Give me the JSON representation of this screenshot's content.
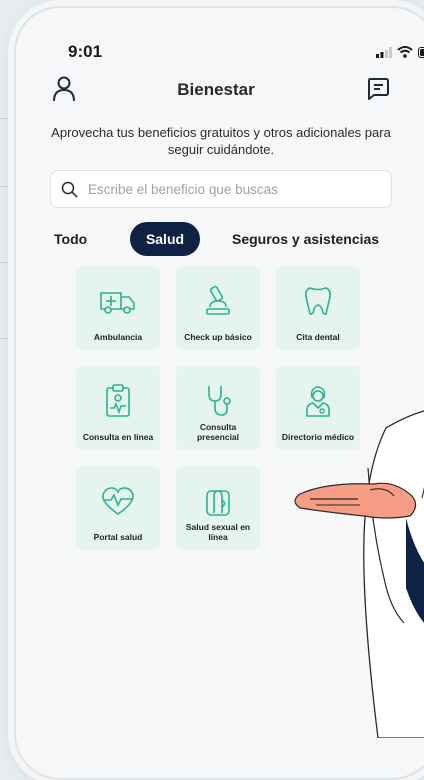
{
  "status_bar": {
    "time": "9:01"
  },
  "header": {
    "title": "Bienestar"
  },
  "intro_text": "Aprovecha tus beneficios gratuitos y otros adicionales para seguir cuidándote.",
  "search": {
    "placeholder": "Escribe el beneficio que buscas"
  },
  "tabs": [
    {
      "label": "Todo",
      "active": false
    },
    {
      "label": "Salud",
      "active": true
    },
    {
      "label": "Seguros y asistencias",
      "active": false
    }
  ],
  "cards": [
    {
      "label": "Ambulancia",
      "icon": "ambulance-icon"
    },
    {
      "label": "Check up básico",
      "icon": "microscope-icon"
    },
    {
      "label": "Cita dental",
      "icon": "tooth-icon"
    },
    {
      "label": "Consulta en línea",
      "icon": "clipboard-icon"
    },
    {
      "label": "Consulta presencial",
      "icon": "stethoscope-icon"
    },
    {
      "label": "Directorio médico",
      "icon": "doctor-icon"
    },
    {
      "label": "Portal salud",
      "icon": "heart-pulse-icon"
    },
    {
      "label": "Salud sexual en línea",
      "icon": "condom-icon"
    }
  ],
  "colors": {
    "accent": "#0e2243",
    "card_bg": "#e5f5ee",
    "icon": "#2bb583"
  }
}
